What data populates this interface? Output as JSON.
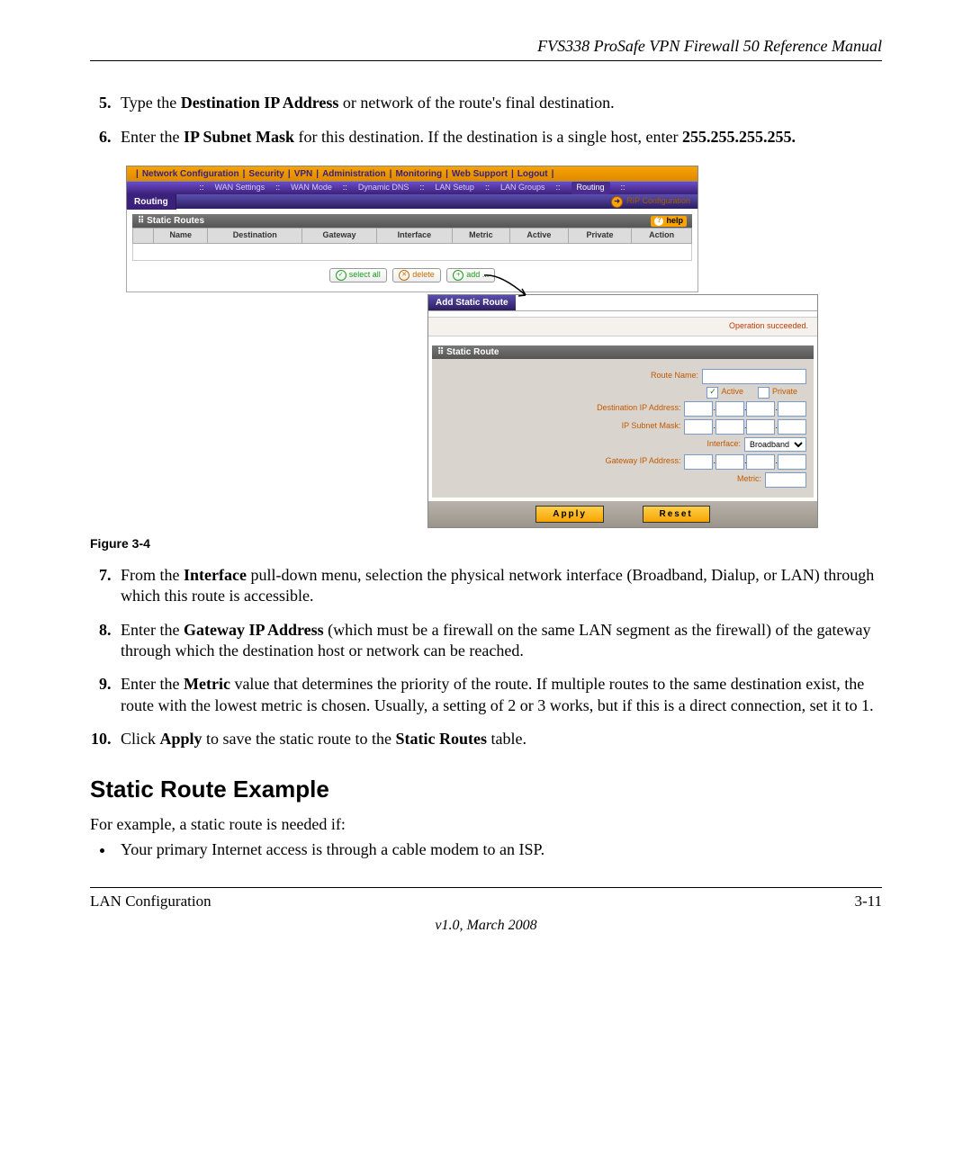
{
  "doc": {
    "header": "FVS338 ProSafe VPN Firewall 50 Reference Manual",
    "step5_a": "Type the ",
    "step5_b": "Destination IP Address",
    "step5_c": " or network of the route's final destination.",
    "step6_a": "Enter the ",
    "step6_b": "IP Subnet Mask",
    "step6_c": " for this destination. If the destination is a single host, enter ",
    "step6_d": "255.255.255.255.",
    "figcap": "Figure 3-4",
    "step7_a": "From the ",
    "step7_b": "Interface",
    "step7_c": " pull-down menu, selection the physical network interface (Broadband, Dialup, or LAN) through which this route is accessible.",
    "step8_a": "Enter the ",
    "step8_b": "Gateway IP Address",
    "step8_c": " (which must be a firewall on the same LAN segment as the firewall) of the gateway through which the destination host or network can be reached.",
    "step9_a": "Enter the ",
    "step9_b": "Metric",
    "step9_c": " value that determines the priority of the route. If multiple routes to the same destination exist, the route with the lowest metric is chosen. Usually, a setting of 2 or 3 works, but if this is a direct connection, set it to 1.",
    "step10_a": "Click ",
    "step10_b": "Apply",
    "step10_c": " to save the static route to the ",
    "step10_d": "Static Routes",
    "step10_e": " table.",
    "h2": "Static Route Example",
    "p1": "For example, a static route is needed if:",
    "bul1": "Your primary Internet access is through a cable modem to an ISP.",
    "footer_left": "LAN Configuration",
    "footer_right": "3-11",
    "footer_ver": "v1.0, March 2008"
  },
  "ui": {
    "nav": [
      "Network Configuration",
      "Security",
      "VPN",
      "Administration",
      "Monitoring",
      "Web Support",
      "Logout"
    ],
    "subnav": [
      "WAN Settings",
      "WAN Mode",
      "Dynamic DNS",
      "LAN Setup",
      "LAN Groups",
      "Routing"
    ],
    "tab": "Routing",
    "rip": "RIP Configuration",
    "section": "Static Routes",
    "help": "help",
    "cols": [
      "Name",
      "Destination",
      "Gateway",
      "Interface",
      "Metric",
      "Active",
      "Private",
      "Action"
    ],
    "selectall": "select all",
    "delete": "delete",
    "add": "add ...",
    "popup_tab": "Add Static Route",
    "success": "Operation succeeded.",
    "popup_section": "Static Route",
    "route_name": "Route Name:",
    "active": "Active",
    "private": "Private",
    "dest_ip": "Destination IP Address:",
    "subnet": "IP Subnet Mask:",
    "interface": "Interface:",
    "iface_opt": "Broadband",
    "gateway": "Gateway IP Address:",
    "metric": "Metric:",
    "apply": "Apply",
    "reset": "Reset"
  }
}
